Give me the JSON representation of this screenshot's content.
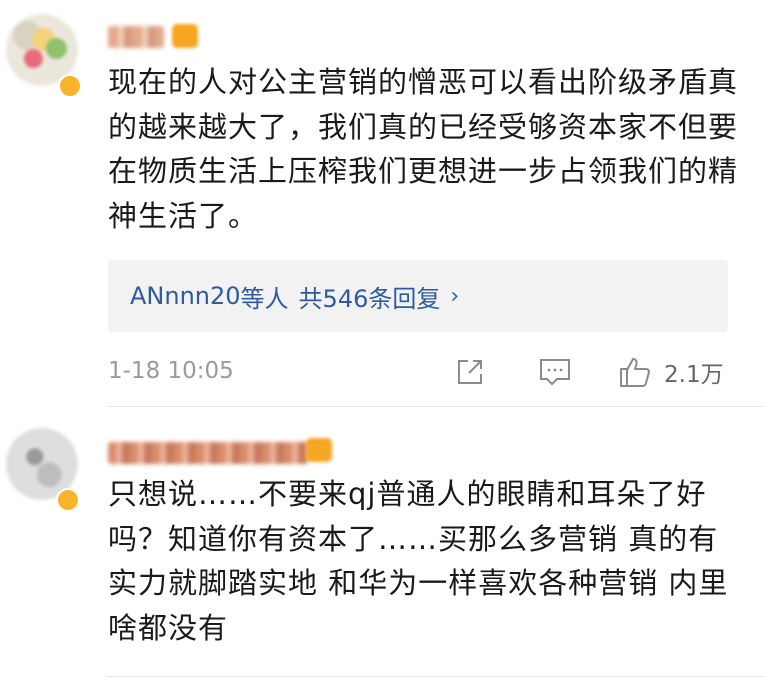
{
  "comments": [
    {
      "text": "现在的人对公主营销的憎恶可以看出阶级矛盾真的越来越大了，我们真的已经受够资本家不但要在物质生活上压榨我们更想进一步占领我们的精神生活了。",
      "replies": {
        "user": "ANnnn20",
        "suffix": "等人",
        "count_text": "共546条回复",
        "chevron": "›"
      },
      "timestamp": "1-18 10:05",
      "likes": "2.1万"
    },
    {
      "text": "只想说……不要来qj普通人的眼睛和耳朵了好吗？知道你有资本了……买那么多营销 真的有实力就脚踏实地 和华为一样喜欢各种营销 内里啥都没有"
    }
  ],
  "icons": {
    "share": "share-icon",
    "reply": "comment-icon",
    "like": "thumbs-up-icon"
  },
  "colors": {
    "link": "#2d5b9e",
    "meta": "#9a9a9a",
    "reply_bg": "#f2f2f2"
  }
}
